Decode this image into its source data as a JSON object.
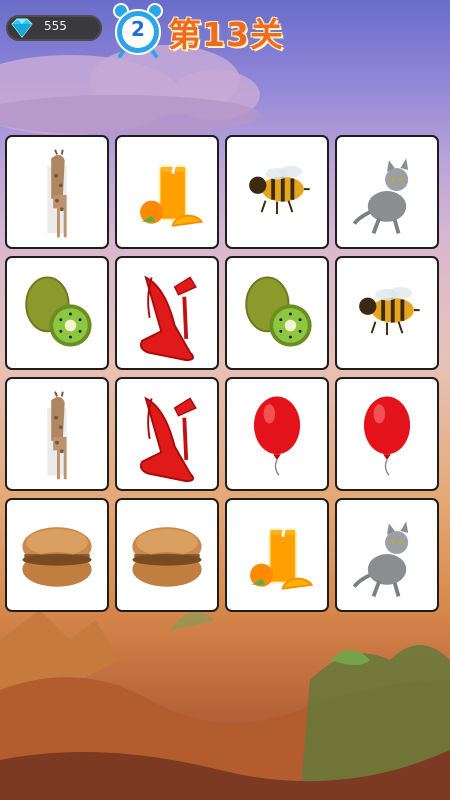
{
  "hud": {
    "gem_count": "555",
    "level_number": "2",
    "level_title": "第13关"
  },
  "board": {
    "rows": 4,
    "columns": 4,
    "cards": [
      {
        "item": "giraffe-icon"
      },
      {
        "item": "orange-juice-icon"
      },
      {
        "item": "bee-icon"
      },
      {
        "item": "cat-icon"
      },
      {
        "item": "kiwi-icon"
      },
      {
        "item": "red-high-heel-icon"
      },
      {
        "item": "kiwi-icon"
      },
      {
        "item": "bee-icon"
      },
      {
        "item": "giraffe-icon"
      },
      {
        "item": "red-high-heel-icon"
      },
      {
        "item": "red-balloon-icon"
      },
      {
        "item": "red-balloon-icon"
      },
      {
        "item": "macaron-icon"
      },
      {
        "item": "macaron-icon"
      },
      {
        "item": "orange-juice-icon"
      },
      {
        "item": "cat-icon"
      }
    ]
  },
  "colors": {
    "title": "#f06a24",
    "gem": "#2ec7f0",
    "clock": "#2aa6e8",
    "card_border": "#1e1e1e"
  }
}
